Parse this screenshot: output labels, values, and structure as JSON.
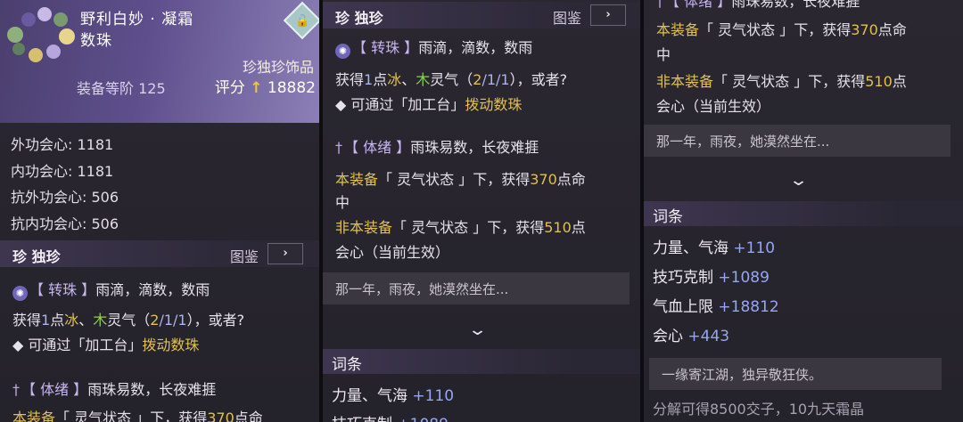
{
  "item": {
    "name_line1": "野利白妙 · 凝霜",
    "name_line2": "数珠",
    "lock_icon": "unlock-icon",
    "rarity_label": "珍独珍饰品",
    "equip_level_label": "装备等阶 125",
    "score_label": "评分",
    "score_arrow": "↑",
    "score_value": "18882"
  },
  "stats": [
    {
      "label": "外功会心:",
      "value": "1181"
    },
    {
      "label": "内功会心:",
      "value": "1181"
    },
    {
      "label": "抗外功会心:",
      "value": "506"
    },
    {
      "label": "抗内功会心:",
      "value": "506"
    }
  ],
  "section": {
    "rarity_tag": "珍",
    "title": "独珍",
    "codex_label": "图鉴",
    "codex_icon": "›"
  },
  "skill1": {
    "icon": "swirl-icon",
    "tag": "【 转珠 】",
    "desc": "雨滴，滴数，数雨",
    "effect_prefix": "获得",
    "effect_num": "1",
    "effect_unit": "点",
    "effect_ice": "冰",
    "sep": "、",
    "effect_wood": "木",
    "effect_qi": "灵气（",
    "ratio_a": "2",
    "ratio_b": "/1/1",
    "effect_end": "），或者?",
    "hint_bullet": "◆",
    "hint_pre": "可通过「加工台」",
    "hint_action": "拨动数珠"
  },
  "skill2": {
    "icon": "sword-icon",
    "tag": "【 体绪 】",
    "desc": "雨珠易数，长夜难捱",
    "equip_pre": "本装备",
    "state_label": "「 灵气状态 」下，获得",
    "equip_num": "370",
    "equip_post": "点命",
    "equip_wrap": "中",
    "non_pre": "非本装备",
    "non_state": "「 灵气状态 」下，获得",
    "non_num": "510",
    "non_post": "点",
    "non_wrap": "会心（当前生效）"
  },
  "quote": "那一年，雨夜，她漠然坐在...",
  "expand_icon": "chevron-down-icon",
  "entries_title": "词条",
  "entries": [
    {
      "name": "力量、气海",
      "value": "+110"
    },
    {
      "name": "技巧克制",
      "value": "+1089"
    },
    {
      "name": "气血上限",
      "value": "+18812"
    },
    {
      "name": "会心",
      "value": "+443"
    }
  ],
  "quote2": "一缘寄江湖，独异敬狂侠。",
  "decompose": "分解可得8500交子，10九天霜晶",
  "colors": {
    "accent_purple": "#5e4f8c",
    "value_blue": "#96a6f0",
    "highlight_yellow": "#e0c054",
    "wood_green": "#8ccf58"
  }
}
